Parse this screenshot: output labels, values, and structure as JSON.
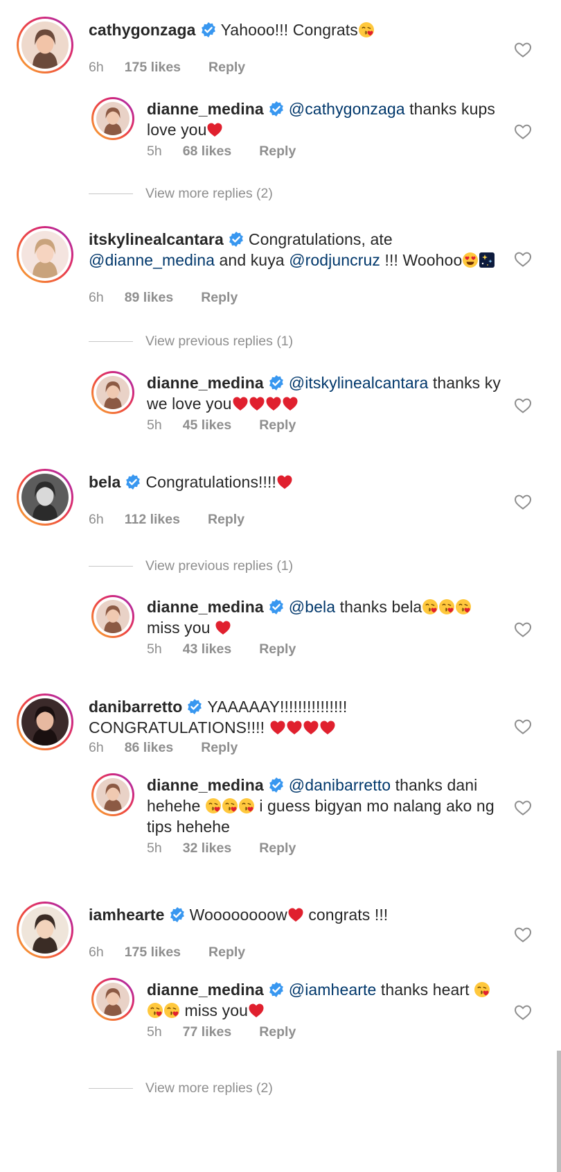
{
  "colors": {
    "verified": "#3897f0",
    "mention": "#00376b",
    "meta": "#8e8e8e",
    "heart_emoji": "#e0202e"
  },
  "threads": [
    {
      "comment": {
        "username": "cathygonzaga",
        "body": [
          {
            "t": "text",
            "v": "Yahooo!!! Congrats"
          },
          {
            "t": "emoji",
            "v": "kiss"
          }
        ],
        "time": "6h",
        "likes": "175 likes",
        "reply": "Reply"
      },
      "reply": {
        "username": "dianne_medina",
        "body": [
          {
            "t": "mention",
            "v": "@cathygonzaga"
          },
          {
            "t": "text",
            "v": " thanks kups love you"
          },
          {
            "t": "emoji",
            "v": "heart"
          }
        ],
        "time": "5h",
        "likes": "68 likes",
        "reply": "Reply"
      },
      "more": "View more replies (2)"
    },
    {
      "comment": {
        "username": "itskylinealcantara",
        "body": [
          {
            "t": "text",
            "v": "Congratulations, ate "
          },
          {
            "t": "mention",
            "v": "@dianne_medina"
          },
          {
            "t": "text",
            "v": " and kuya "
          },
          {
            "t": "mention",
            "v": "@rodjuncruz"
          },
          {
            "t": "text",
            "v": " !!! Woohoo"
          },
          {
            "t": "emoji",
            "v": "heart-eyes"
          },
          {
            "t": "emoji",
            "v": "sparkle"
          }
        ],
        "time": "6h",
        "likes": "89 likes",
        "reply": "Reply"
      },
      "more": "View previous replies (1)",
      "reply": {
        "username": "dianne_medina",
        "body": [
          {
            "t": "mention",
            "v": "@itskylinealcantara"
          },
          {
            "t": "text",
            "v": " thanks ky we love you"
          },
          {
            "t": "emoji",
            "v": "heart"
          },
          {
            "t": "emoji",
            "v": "heart"
          },
          {
            "t": "emoji",
            "v": "heart"
          },
          {
            "t": "emoji",
            "v": "heart"
          }
        ],
        "time": "5h",
        "likes": "45 likes",
        "reply": "Reply"
      }
    },
    {
      "comment": {
        "username": "bela",
        "body": [
          {
            "t": "text",
            "v": "Congratulations!!!!"
          },
          {
            "t": "emoji",
            "v": "heart"
          }
        ],
        "time": "6h",
        "likes": "112 likes",
        "reply": "Reply"
      },
      "more": "View previous replies (1)",
      "reply": {
        "username": "dianne_medina",
        "body": [
          {
            "t": "mention",
            "v": "@bela"
          },
          {
            "t": "text",
            "v": " thanks bela"
          },
          {
            "t": "emoji",
            "v": "kiss"
          },
          {
            "t": "emoji",
            "v": "kiss"
          },
          {
            "t": "emoji",
            "v": "kiss"
          },
          {
            "t": "text",
            "v": " miss you "
          },
          {
            "t": "emoji",
            "v": "heart"
          }
        ],
        "time": "5h",
        "likes": "43 likes",
        "reply": "Reply"
      }
    },
    {
      "comment": {
        "username": "danibarretto",
        "body": [
          {
            "t": "text",
            "v": "YAAAAAY!!!!!!!!!!!!!!! CONGRATULATIONS!!!! "
          },
          {
            "t": "emoji",
            "v": "heart"
          },
          {
            "t": "emoji",
            "v": "heart"
          },
          {
            "t": "emoji",
            "v": "heart"
          },
          {
            "t": "emoji",
            "v": "heart"
          }
        ],
        "time": "6h",
        "likes": "86 likes",
        "reply": "Reply"
      },
      "reply": {
        "username": "dianne_medina",
        "body": [
          {
            "t": "mention",
            "v": "@danibarretto"
          },
          {
            "t": "text",
            "v": " thanks dani hehehe "
          },
          {
            "t": "emoji",
            "v": "kiss"
          },
          {
            "t": "emoji",
            "v": "kiss"
          },
          {
            "t": "emoji",
            "v": "kiss"
          },
          {
            "t": "text",
            "v": " i guess bigyan mo nalang ako ng tips hehehe"
          }
        ],
        "time": "5h",
        "likes": "32 likes",
        "reply": "Reply"
      }
    },
    {
      "comment": {
        "username": "iamhearte",
        "body": [
          {
            "t": "text",
            "v": "Woooooooow"
          },
          {
            "t": "emoji",
            "v": "heart"
          },
          {
            "t": "text",
            "v": " congrats !!!"
          }
        ],
        "time": "6h",
        "likes": "175 likes",
        "reply": "Reply"
      },
      "reply": {
        "username": "dianne_medina",
        "body": [
          {
            "t": "mention",
            "v": "@iamhearte"
          },
          {
            "t": "text",
            "v": " thanks heart "
          },
          {
            "t": "emoji",
            "v": "kiss"
          },
          {
            "t": "emoji",
            "v": "kiss"
          },
          {
            "t": "emoji",
            "v": "kiss"
          },
          {
            "t": "text",
            "v": " miss you"
          },
          {
            "t": "emoji",
            "v": "heart"
          }
        ],
        "time": "5h",
        "likes": "77 likes",
        "reply": "Reply"
      },
      "more": "View more replies (2)"
    }
  ]
}
